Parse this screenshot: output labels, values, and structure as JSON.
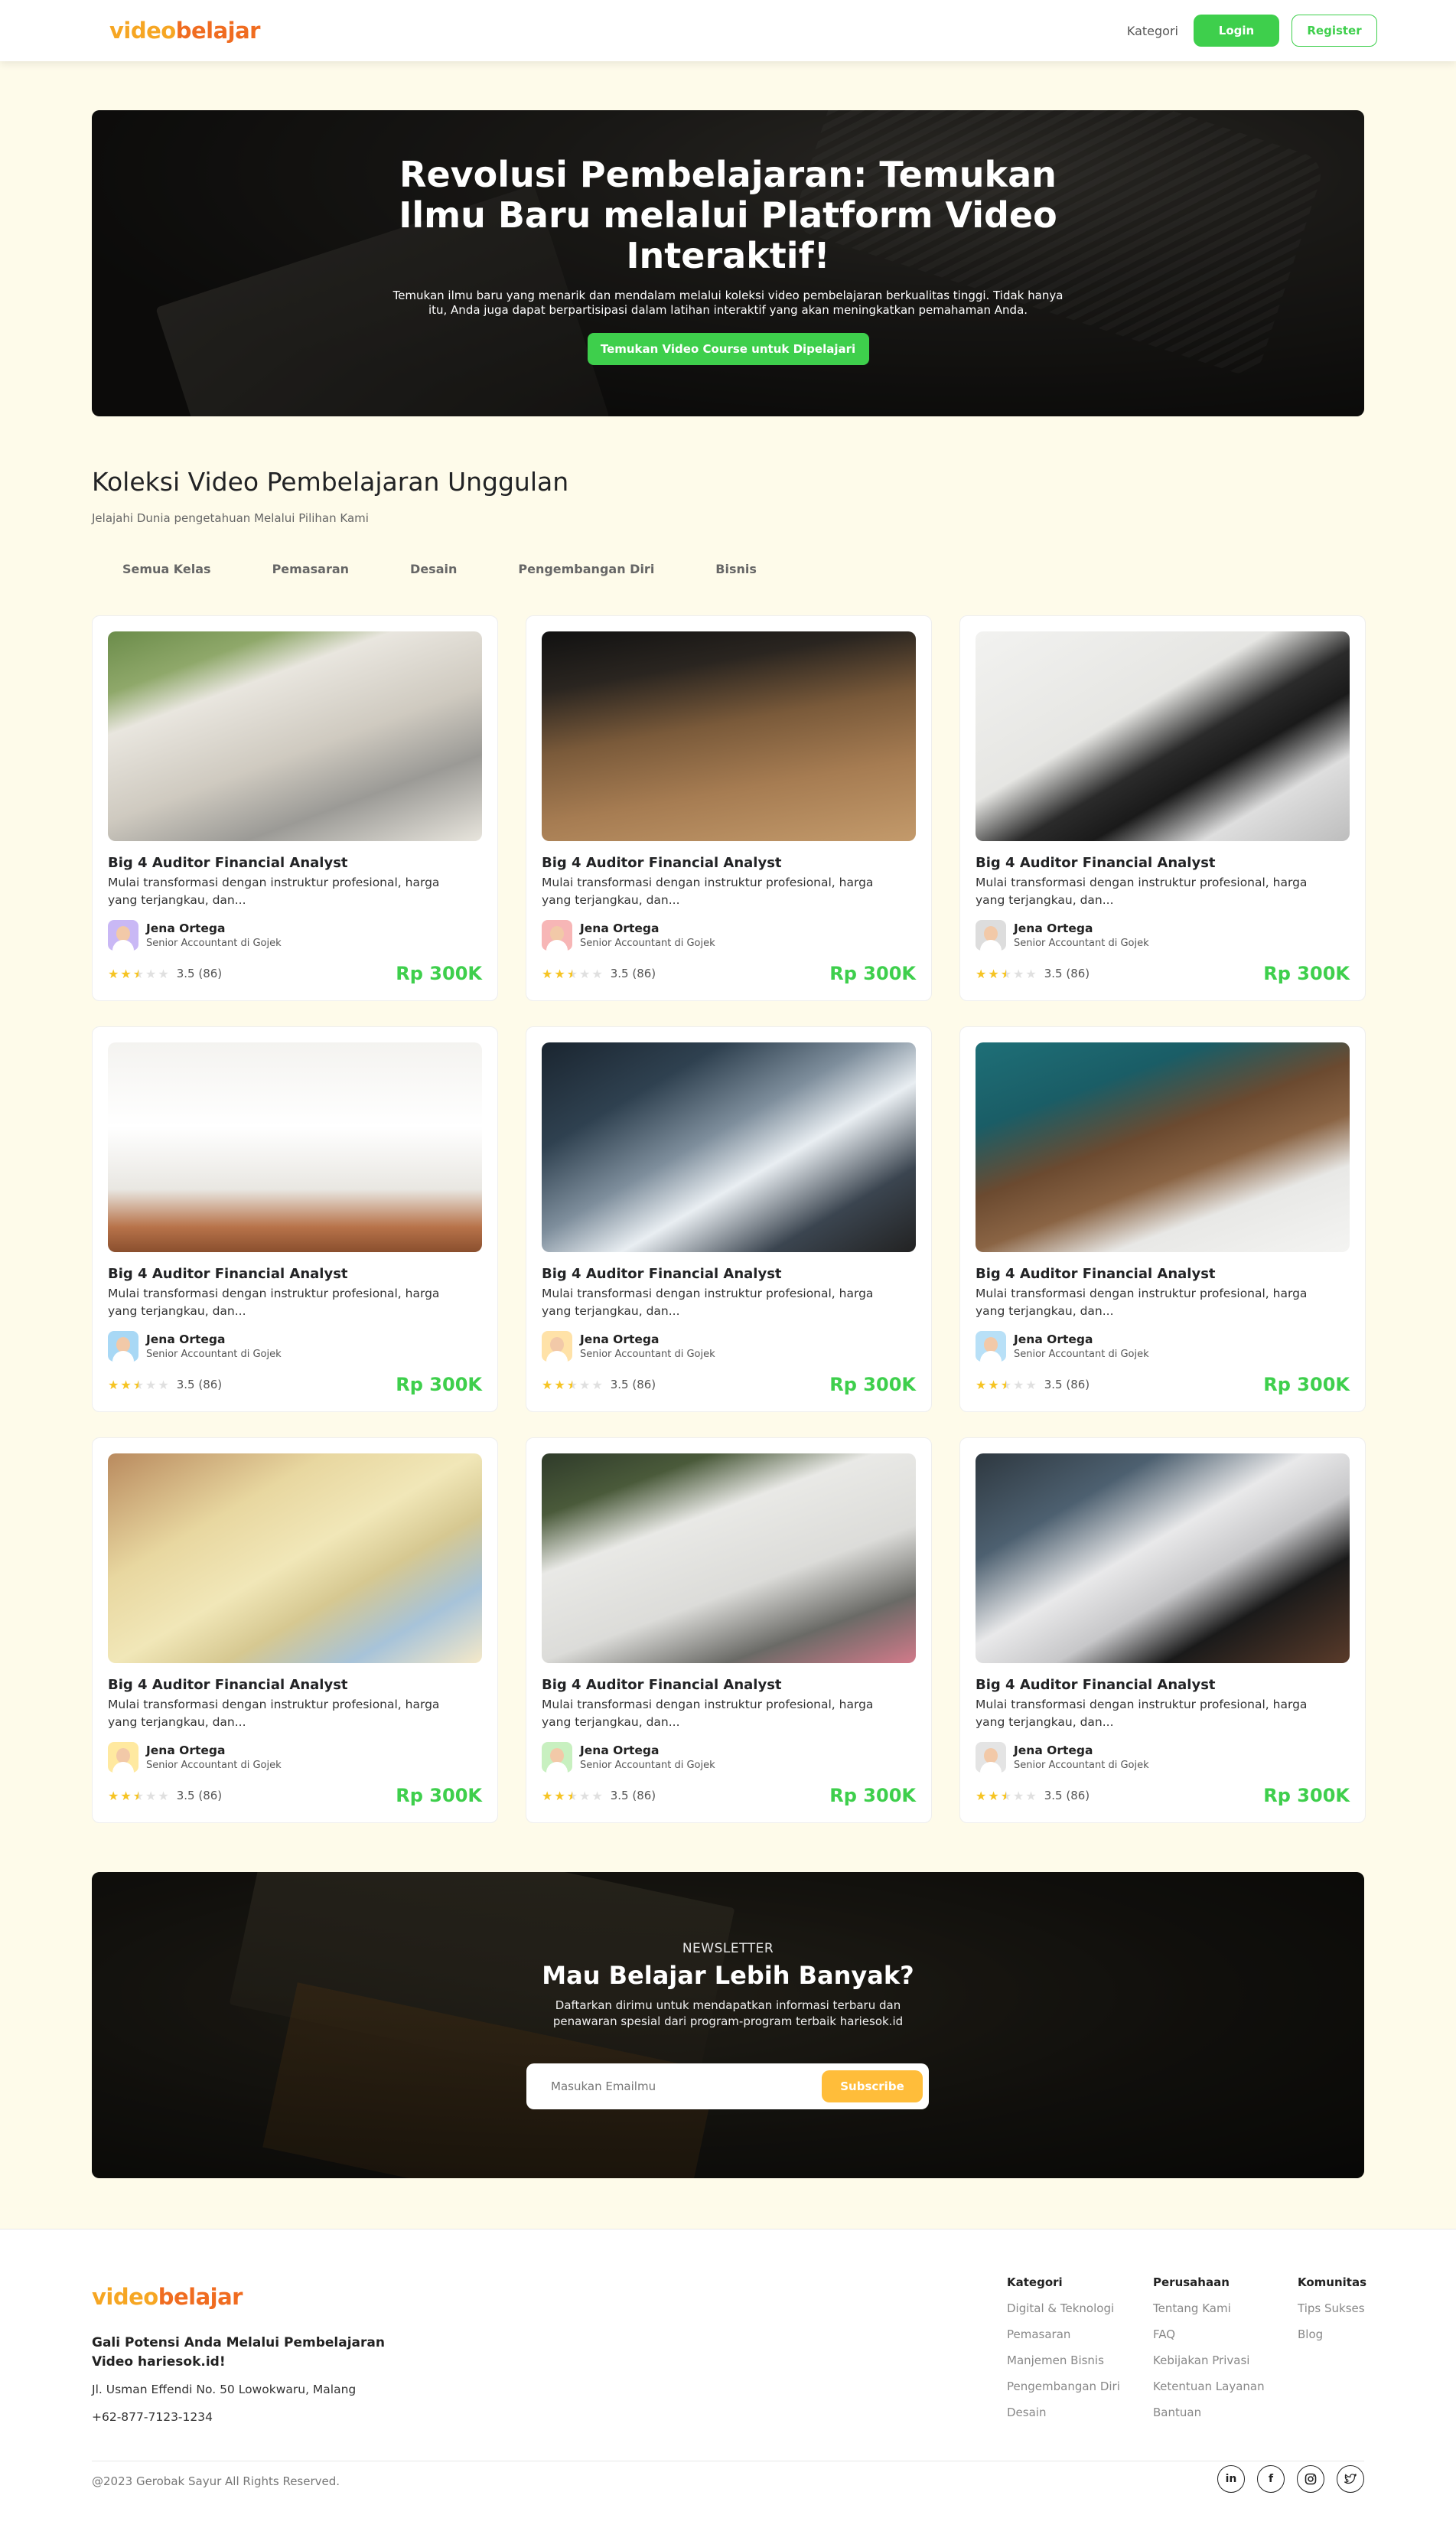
{
  "header": {
    "logo_part1": "video",
    "logo_part2": "belajar",
    "kategori": "Kategori",
    "login": "Login",
    "register": "Register"
  },
  "hero": {
    "title": "Revolusi Pembelajaran: Temukan Ilmu Baru melalui Platform Video Interaktif!",
    "subtitle": "Temukan ilmu baru yang menarik dan mendalam melalui koleksi video pembelajaran berkualitas tinggi. Tidak hanya itu, Anda juga dapat berpartisipasi dalam latihan interaktif yang akan meningkatkan pemahaman Anda.",
    "cta": "Temukan Video Course untuk Dipelajari"
  },
  "collection": {
    "title": "Koleksi Video Pembelajaran Unggulan",
    "subtitle": "Jelajahi Dunia pengetahuan Melalui Pilihan Kami",
    "tabs": [
      "Semua Kelas",
      "Pemasaran",
      "Desain",
      "Pengembangan Diri",
      "Bisnis"
    ]
  },
  "cards": [
    {
      "title": "Big 4 Auditor Financial Analyst",
      "desc": "Mulai transformasi dengan instruktur profesional, harga yang terjangkau, dan...",
      "author": "Jena Ortega",
      "role": "Senior Accountant di Gojek",
      "rating_text": "3.5 (86)",
      "rating": 2.5,
      "price": "Rp 300K",
      "avatar_color": "#C9B8F5"
    },
    {
      "title": "Big 4 Auditor Financial Analyst",
      "desc": "Mulai transformasi dengan instruktur profesional, harga yang terjangkau, dan...",
      "author": "Jena Ortega",
      "role": "Senior Accountant di Gojek",
      "rating_text": "3.5 (86)",
      "rating": 2.5,
      "price": "Rp 300K",
      "avatar_color": "#F7B6B6"
    },
    {
      "title": "Big 4 Auditor Financial Analyst",
      "desc": "Mulai transformasi dengan instruktur profesional, harga yang terjangkau, dan...",
      "author": "Jena Ortega",
      "role": "Senior Accountant di Gojek",
      "rating_text": "3.5 (86)",
      "rating": 2.5,
      "price": "Rp 300K",
      "avatar_color": "#DDDDDD"
    },
    {
      "title": "Big 4 Auditor Financial Analyst",
      "desc": "Mulai transformasi dengan instruktur profesional, harga yang terjangkau, dan...",
      "author": "Jena Ortega",
      "role": "Senior Accountant di Gojek",
      "rating_text": "3.5 (86)",
      "rating": 2.5,
      "price": "Rp 300K",
      "avatar_color": "#A8D8F5"
    },
    {
      "title": "Big 4 Auditor Financial Analyst",
      "desc": "Mulai transformasi dengan instruktur profesional, harga yang terjangkau, dan...",
      "author": "Jena Ortega",
      "role": "Senior Accountant di Gojek",
      "rating_text": "3.5 (86)",
      "rating": 2.5,
      "price": "Rp 300K",
      "avatar_color": "#FFE2A8"
    },
    {
      "title": "Big 4 Auditor Financial Analyst",
      "desc": "Mulai transformasi dengan instruktur profesional, harga yang terjangkau, dan...",
      "author": "Jena Ortega",
      "role": "Senior Accountant di Gojek",
      "rating_text": "3.5 (86)",
      "rating": 2.5,
      "price": "Rp 300K",
      "avatar_color": "#B8E0F7"
    },
    {
      "title": "Big 4 Auditor Financial Analyst",
      "desc": "Mulai transformasi dengan instruktur profesional, harga yang terjangkau, dan...",
      "author": "Jena Ortega",
      "role": "Senior Accountant di Gojek",
      "rating_text": "3.5 (86)",
      "rating": 2.5,
      "price": "Rp 300K",
      "avatar_color": "#FFE9A0"
    },
    {
      "title": "Big 4 Auditor Financial Analyst",
      "desc": "Mulai transformasi dengan instruktur profesional, harga yang terjangkau, dan...",
      "author": "Jena Ortega",
      "role": "Senior Accountant di Gojek",
      "rating_text": "3.5 (86)",
      "rating": 2.5,
      "price": "Rp 300K",
      "avatar_color": "#C8F0C0"
    },
    {
      "title": "Big 4 Auditor Financial Analyst",
      "desc": "Mulai transformasi dengan instruktur profesional, harga yang terjangkau, dan...",
      "author": "Jena Ortega",
      "role": "Senior Accountant di Gojek",
      "rating_text": "3.5 (86)",
      "rating": 2.5,
      "price": "Rp 300K",
      "avatar_color": "#E4E4E4"
    }
  ],
  "newsletter": {
    "kicker": "NEWSLETTER",
    "title": "Mau Belajar Lebih Banyak?",
    "subtitle": "Daftarkan dirimu untuk mendapatkan informasi terbaru dan penawaran spesial dari program-program terbaik hariesok.id",
    "placeholder": "Masukan Emailmu",
    "button": "Subscribe"
  },
  "footer": {
    "logo_part1": "video",
    "logo_part2": "belajar",
    "tagline": "Gali Potensi Anda Melalui Pembelajaran Video hariesok.id!",
    "address": "Jl. Usman Effendi No. 50 Lowokwaru, Malang",
    "phone": "+62-877-7123-1234",
    "columns": [
      {
        "heading": "Kategori",
        "links": [
          "Digital & Teknologi",
          "Pemasaran",
          "Manjemen Bisnis",
          "Pengembangan Diri",
          "Desain"
        ]
      },
      {
        "heading": "Perusahaan",
        "links": [
          "Tentang Kami",
          "FAQ",
          "Kebijakan Privasi",
          "Ketentuan Layanan",
          "Bantuan"
        ]
      },
      {
        "heading": "Komunitas",
        "links": [
          "Tips Sukses",
          "Blog"
        ]
      }
    ],
    "copyright": "@2023 Gerobak Sayur All Rights Reserved.",
    "socials": [
      "linkedin-icon",
      "facebook-icon",
      "instagram-icon",
      "twitter-icon"
    ]
  },
  "colors": {
    "primary_green": "#3ECF4C",
    "accent_orange": "#F6A623",
    "accent_red_orange": "#F06C20",
    "subscribe_yellow": "#FFBD3A",
    "page_bg": "#FEFBEA"
  }
}
